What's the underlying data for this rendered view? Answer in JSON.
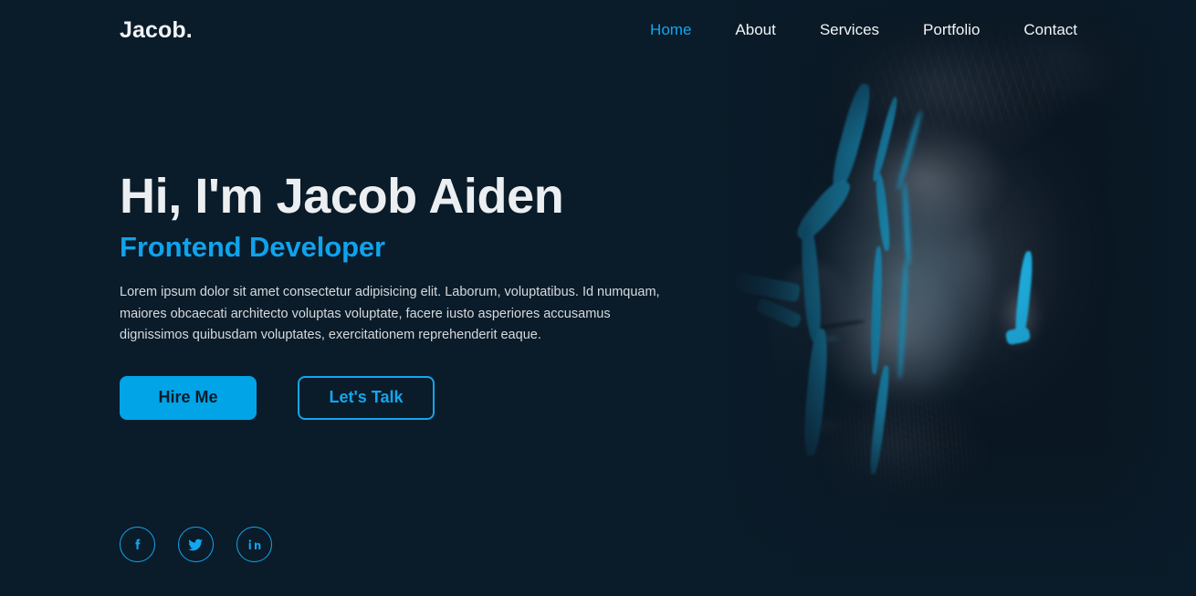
{
  "theme": {
    "background": "#0a1b29",
    "accent": "#12a6ef",
    "button_fill": "#02a4e8",
    "text_primary": "#eceff1",
    "text_body": "#d6dadd"
  },
  "header": {
    "logo": "Jacob.",
    "nav": [
      {
        "label": "Home",
        "active": true
      },
      {
        "label": "About",
        "active": false
      },
      {
        "label": "Services",
        "active": false
      },
      {
        "label": "Portfolio",
        "active": false
      },
      {
        "label": "Contact",
        "active": false
      }
    ]
  },
  "hero": {
    "title": "Hi, I'm Jacob Aiden",
    "subtitle": "Frontend Developer",
    "description": "Lorem ipsum dolor sit amet consectetur adipisicing elit. Laborum, voluptatibus. Id numquam, maiores obcaecati architecto voluptas voluptate, facere iusto asperiores accusamus dignissimos quibusdam voluptates, exercitationem reprehenderit eaque.",
    "primary_button": "Hire Me",
    "secondary_button": "Let's Talk"
  },
  "socials": [
    {
      "name": "facebook-icon",
      "label": "Facebook"
    },
    {
      "name": "twitter-icon",
      "label": "Twitter"
    },
    {
      "name": "linkedin-icon",
      "label": "LinkedIn"
    }
  ],
  "hero_image": {
    "description": "Portrait of a bearded man with glowing blue face paint stripes on a dark background"
  }
}
